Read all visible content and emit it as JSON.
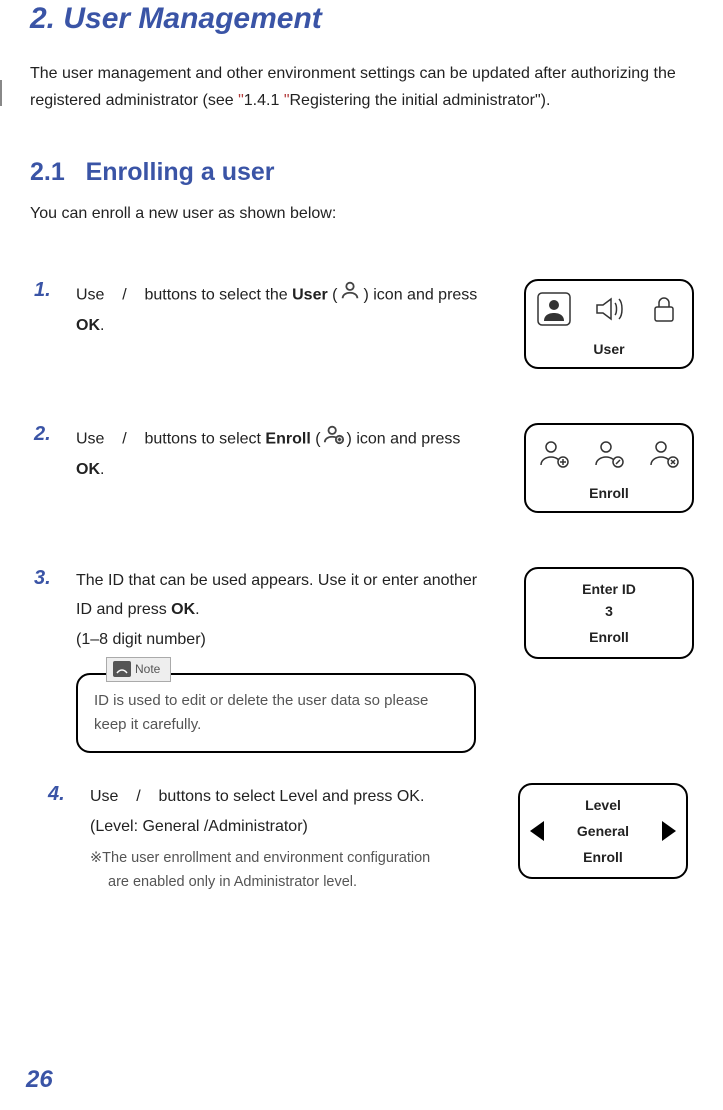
{
  "page": {
    "title": "2. User Management",
    "intro_pre": "The user management and other environment settings can be updated after authorizing the registered administrator (see ",
    "intro_q": "\"",
    "intro_ref": "1.4.1 ",
    "intro_q2": "\"",
    "intro_refTitle": "Registering the initial administrator\").",
    "section_num": "2.1",
    "section_title": "Enrolling a user",
    "section_intro": "You can enroll a new user as shown below:",
    "page_number": "26"
  },
  "steps": {
    "s1": {
      "num": "1.",
      "text_pre": "Use    /    buttons to select the ",
      "bold1": "User",
      "text_mid": " (",
      "icon": "user-icon",
      "text_post": ") icon and press ",
      "bold2": "OK",
      "text_end": ".",
      "panel": {
        "label": "User"
      }
    },
    "s2": {
      "num": "2.",
      "text_pre": "Use    /    buttons to select ",
      "bold1": "Enroll",
      "text_mid": " (",
      "icon": "enroll-icon",
      "text_post": ") icon and press ",
      "bold2": "OK",
      "text_end": ".",
      "panel": {
        "label": "Enroll"
      }
    },
    "s3": {
      "num": "3.",
      "line1_pre": "The ID that can be used appears. Use it or enter another ID and press ",
      "line1_bold": "OK",
      "line1_post": ".",
      "line2": "(1–8 digit number)",
      "note": "ID is used to edit or delete the user data so please keep it carefully.",
      "note_label": "Note",
      "panel": {
        "title": "Enter ID",
        "value": "3",
        "label": "Enroll"
      }
    },
    "s4": {
      "num": "4.",
      "line1": "Use    /    buttons to select Level and press OK.",
      "line2": "(Level: General /Administrator)",
      "foot1": "※The user enrollment and environment configuration",
      "foot2": "are enabled only in Administrator level.",
      "panel": {
        "title": "Level",
        "value": "General",
        "label": "Enroll"
      }
    }
  }
}
